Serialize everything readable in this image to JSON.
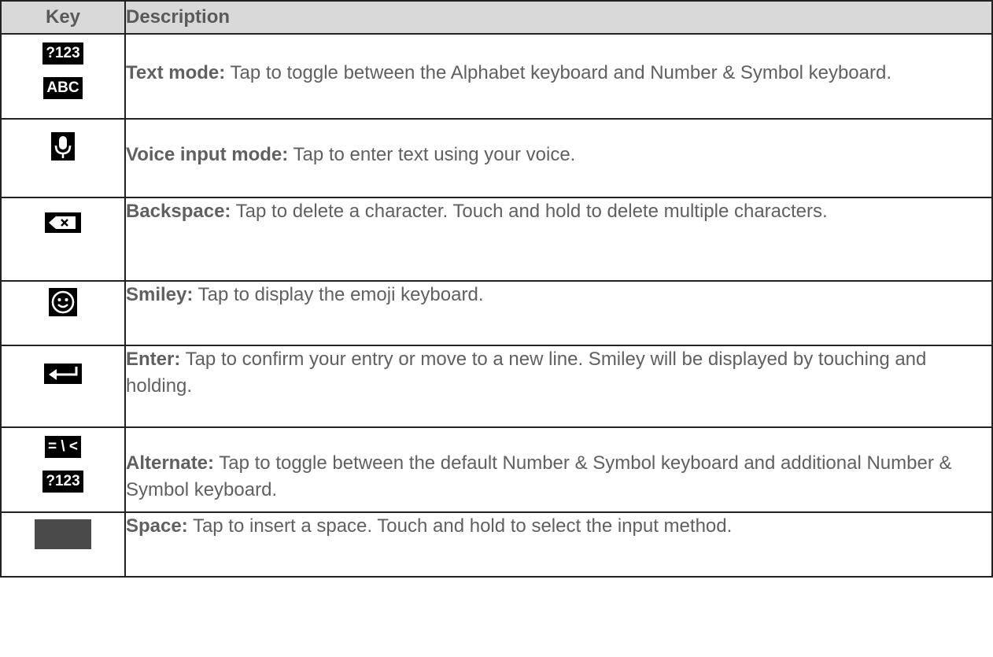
{
  "header": {
    "key": "Key",
    "description": "Description"
  },
  "rows": [
    {
      "keys": [
        {
          "icon": "text-mode-key-icon",
          "text": "?123"
        },
        {
          "icon": "alphabet-key-icon",
          "text": "ABC"
        }
      ],
      "term": "Text mode:",
      "text": " Tap to toggle between the Alphabet keyboard and Number & Symbol keyboard."
    },
    {
      "keys": [
        {
          "icon": "microphone-icon"
        }
      ],
      "term": "Voice input mode:",
      "text": " Tap to enter text using your voice."
    },
    {
      "keys": [
        {
          "icon": "backspace-icon"
        }
      ],
      "term": "Backspace:",
      "text": " Tap to delete a character. Touch and hold to delete multiple characters."
    },
    {
      "keys": [
        {
          "icon": "smiley-icon"
        }
      ],
      "term": "Smiley:",
      "text": " Tap to display the emoji keyboard."
    },
    {
      "keys": [
        {
          "icon": "enter-arrow-icon"
        }
      ],
      "term": "Enter:",
      "text": " Tap to confirm your entry or move to a new line. Smiley will be displayed by touching and holding."
    },
    {
      "keys": [
        {
          "icon": "alternate-symbols-key-icon",
          "text": "= \\ <"
        },
        {
          "icon": "number-symbol-key-icon",
          "text": "?123"
        }
      ],
      "term": "Alternate:",
      "text": " Tap to toggle between the default Number & Symbol keyboard and additional Number & Symbol keyboard."
    },
    {
      "keys": [
        {
          "icon": "space-bar-icon"
        }
      ],
      "term": "Space:",
      "text": " Tap to insert a space. Touch and hold to select the input method."
    }
  ]
}
